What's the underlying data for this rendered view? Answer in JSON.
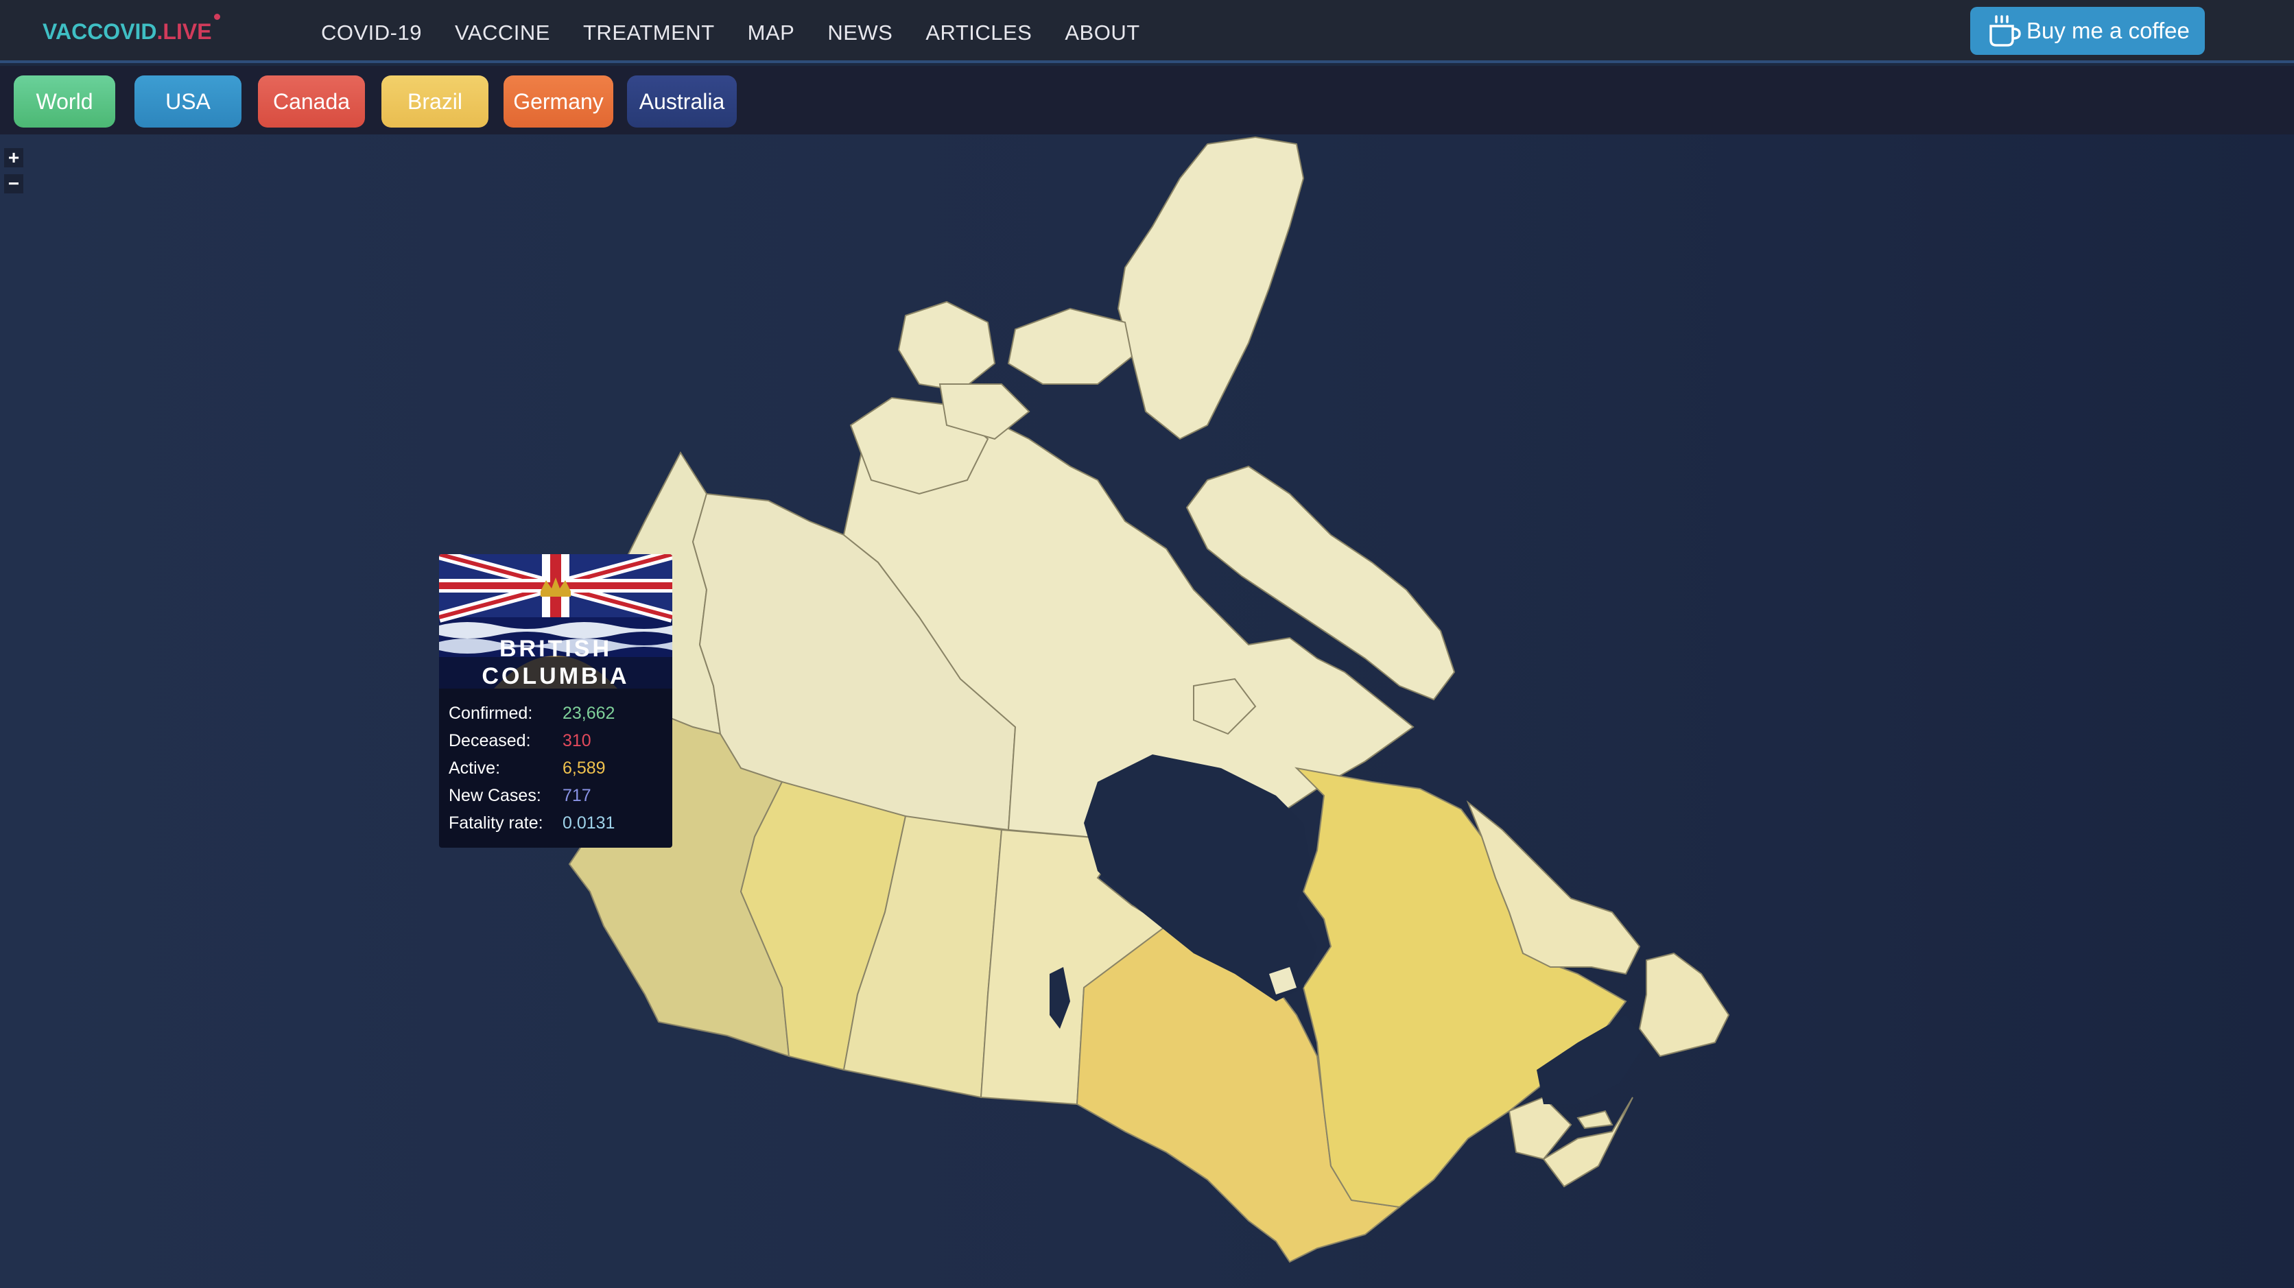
{
  "header": {
    "logo_part1": "VACCOVID",
    "logo_part2": ".LIVE",
    "nav": [
      "COVID-19",
      "VACCINE",
      "TREATMENT",
      "MAP",
      "NEWS",
      "ARTICLES",
      "ABOUT"
    ],
    "coffee_label": "Buy me a coffee"
  },
  "countries": [
    {
      "label": "World",
      "color": "#5cc58a"
    },
    {
      "label": "USA",
      "color": "#3593c9"
    },
    {
      "label": "Canada",
      "color": "#e05a4d"
    },
    {
      "label": "Brazil",
      "color": "#ecc65a"
    },
    {
      "label": "Germany",
      "color": "#e8743b"
    },
    {
      "label": "Australia",
      "color": "#2d3f7d"
    }
  ],
  "zoom": {
    "in": "+",
    "out": "−"
  },
  "tooltip": {
    "title_line1": "BRITISH",
    "title_line2": "COLUMBIA",
    "rows": [
      {
        "label": "Confirmed:",
        "value": "23,662",
        "color": "#7fd19a"
      },
      {
        "label": "Deceased:",
        "value": "310",
        "color": "#e24a5c"
      },
      {
        "label": "Active:",
        "value": "6,589",
        "color": "#f0c24e"
      },
      {
        "label": "New Cases:",
        "value": "717",
        "color": "#8a93e6"
      },
      {
        "label": "Fatality rate:",
        "value": "0.0131",
        "color": "#9fd3ea"
      }
    ]
  },
  "map": {
    "land_color": "#eee9c4",
    "water_color": "#1d2a46",
    "provinces": [
      {
        "name": "Yukon",
        "fill": "#eae6c0"
      },
      {
        "name": "Northwest Territories",
        "fill": "#ebe6c2"
      },
      {
        "name": "Nunavut",
        "fill": "#eee9c4"
      },
      {
        "name": "British Columbia",
        "fill": "#d8cd8a"
      },
      {
        "name": "Alberta",
        "fill": "#e8da85"
      },
      {
        "name": "Saskatchewan",
        "fill": "#ebe2a8"
      },
      {
        "name": "Manitoba",
        "fill": "#eee6b4"
      },
      {
        "name": "Ontario",
        "fill": "#eace6e"
      },
      {
        "name": "Quebec",
        "fill": "#e9d46c"
      },
      {
        "name": "Newfoundland and Labrador",
        "fill": "#eee6b8"
      },
      {
        "name": "New Brunswick",
        "fill": "#eee6b8"
      },
      {
        "name": "Nova Scotia",
        "fill": "#eee6b8"
      },
      {
        "name": "Prince Edward Island",
        "fill": "#eee6b8"
      }
    ]
  }
}
